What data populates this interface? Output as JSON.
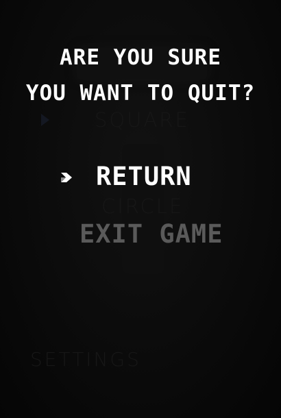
{
  "background_menu": {
    "items": [
      "SQUARE",
      "CIRCLE",
      "SETTINGS"
    ]
  },
  "dialog": {
    "title_lines": [
      "ARE YOU SURE",
      "YOU WANT TO QUIT?"
    ],
    "options": [
      "RETURN",
      "EXIT GAME"
    ],
    "selected_option": "RETURN",
    "selector_icon": "chevron-right-icon"
  },
  "colors": {
    "background": "#070707",
    "text_active": "#ffffff",
    "text_inactive": "#5a5a5a",
    "text_background_menu": "#171717"
  }
}
